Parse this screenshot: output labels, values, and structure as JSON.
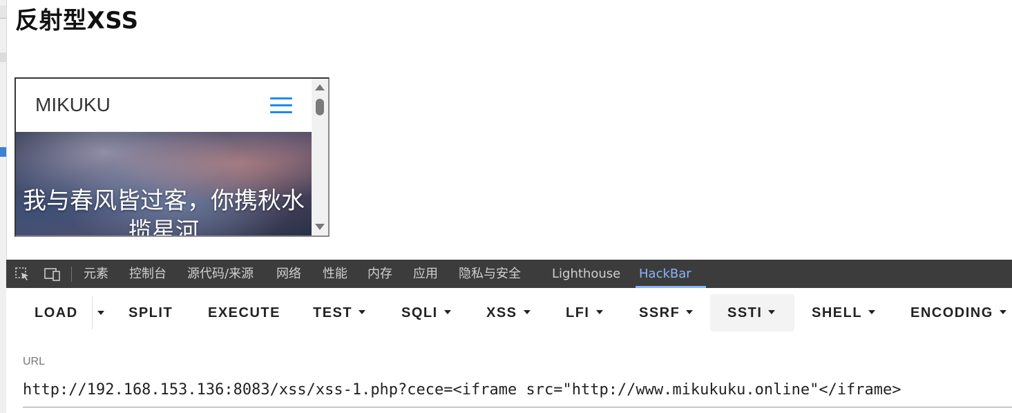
{
  "page": {
    "title": "反射型XSS"
  },
  "iframe": {
    "brand": "MIKUKU",
    "hero_text": "我与春风皆过客，你携秋水揽星河"
  },
  "devtools": {
    "tabs": [
      {
        "label": "元素"
      },
      {
        "label": "控制台"
      },
      {
        "label": "源代码/来源"
      },
      {
        "label": "网络"
      },
      {
        "label": "性能"
      },
      {
        "label": "内存"
      },
      {
        "label": "应用"
      },
      {
        "label": "隐私与安全"
      },
      {
        "label": "Lighthouse"
      },
      {
        "label": "HackBar"
      }
    ],
    "active_tab": "HackBar",
    "active_color": "#8ab4f8"
  },
  "hackbar": {
    "buttons": [
      {
        "label": "LOAD"
      },
      {
        "label": "SPLIT"
      },
      {
        "label": "EXECUTE"
      },
      {
        "label": "TEST"
      },
      {
        "label": "SQLI"
      },
      {
        "label": "XSS"
      },
      {
        "label": "LFI"
      },
      {
        "label": "SSRF"
      },
      {
        "label": "SSTI"
      },
      {
        "label": "SHELL"
      },
      {
        "label": "ENCODING"
      }
    ],
    "url_label": "URL",
    "url_value": "http://192.168.153.136:8083/xss/xss-1.php?cece=<iframe src=\"http://www.mikukuku.online\"</iframe>"
  },
  "colors": {
    "menu_accent": "#1a8cf0",
    "devtools_bg": "#3c3c3c"
  }
}
